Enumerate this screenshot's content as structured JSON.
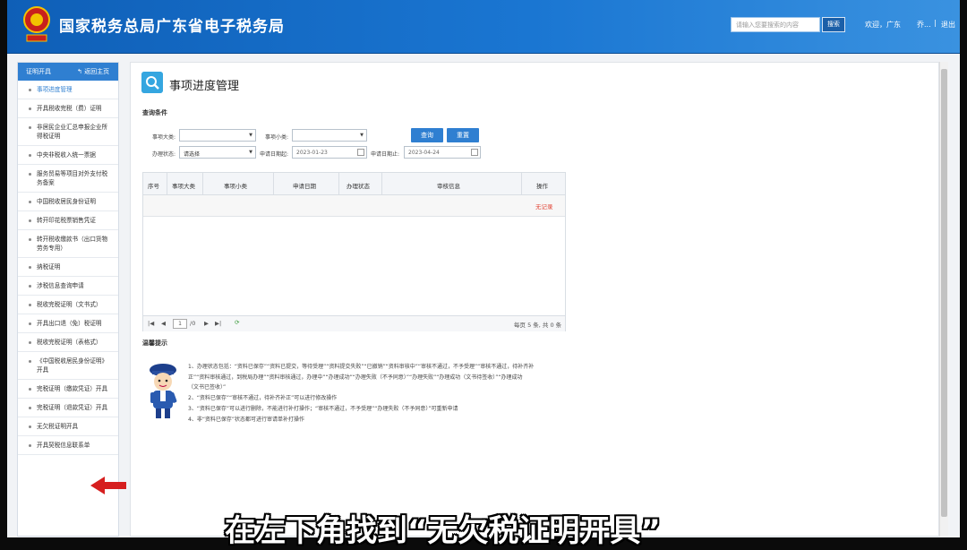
{
  "header": {
    "site_title": "国家税务总局广东省电子税务局",
    "search_placeholder": "请输入您要搜索的内容",
    "search_button": "搜索",
    "welcome": "欢迎，广东",
    "user": "乔...",
    "separator": "|",
    "logout": "退出"
  },
  "sidebar": {
    "title": "证明开具",
    "back": "返回主页",
    "items": [
      {
        "label": "事项进度管理"
      },
      {
        "label": "开具税收完税（费）证明"
      },
      {
        "label": "非居民企业汇总申报企业所得税证明"
      },
      {
        "label": "中央非税收入统一票据"
      },
      {
        "label": "服务贸易等项目对外支付税务备案"
      },
      {
        "label": "中国税收居民身份证明"
      },
      {
        "label": "转开印花税票销售凭证"
      },
      {
        "label": "转开税收缴款书（出口货物劳务专用）"
      },
      {
        "label": "纳税证明"
      },
      {
        "label": "涉税信息查询申请"
      },
      {
        "label": "税收完税证明（文书式）"
      },
      {
        "label": "开具出口退（免）税证明"
      },
      {
        "label": "税收完税证明（表格式）"
      },
      {
        "label": "《中国税收居民身份证明》开具"
      },
      {
        "label": "完税证明（缴款凭证）开具"
      },
      {
        "label": "完税证明（退款凭证）开具"
      },
      {
        "label": "无欠税证明开具"
      },
      {
        "label": "开具契税信息联系单"
      }
    ]
  },
  "main": {
    "page_title": "事项进度管理",
    "query_label": "查询条件",
    "filters": {
      "matter_type_label": "事项大类:",
      "matter_sub_label": "事项小类:",
      "status_label": "办理状态:",
      "status_value": "请选择",
      "start_label": "申请日期起:",
      "start_value": "2023-01-23",
      "end_label": "申请日期止:",
      "end_value": "2023-04-24",
      "query_button": "查询",
      "reset_button": "重置"
    },
    "table": {
      "columns": [
        "序号",
        "事项大类",
        "事项小类",
        "申请日期",
        "办理状态",
        "审核信息",
        "操作"
      ],
      "no_record": "无记录",
      "pager": {
        "page": "1",
        "total_pages": "/0",
        "summary": "每页 5 条, 共 0 条"
      }
    },
    "tips": {
      "title": "温馨提示",
      "lines": [
        "1、办理状态包括：“资料已保存”“资料已提交，等待受理”“资料提交失败”“已撤销”“资料审核中”“审核不通过，不予受理”“审核不通过，待补齐补",
        "正”“资料审核通过，到税局办理”“资料审核通过，办理中”“办理成功”“办理失败（不予同意）”“办理失败”“办理成功（文书待签收）”“办理成功",
        "（文书已签收）”",
        "2、“资料已保存”“审核不通过，待补齐补正”可以进行修改操作",
        "3、“资料已保存”可以进行删除，不能进行补打操作；“审核不通过，不予受理”“办理失败（不予同意）”可重新申请",
        "4、非“资料已保存”状态都可进行审请单补打操作"
      ]
    }
  },
  "overlay": {
    "subtitle": "在左下角找到“无欠税证明开具”"
  },
  "colors": {
    "header_blue": "#1a76d2",
    "accent_blue": "#2f7fd1",
    "no_record_red": "#e24a3b",
    "arrow_red": "#d61f1f"
  }
}
